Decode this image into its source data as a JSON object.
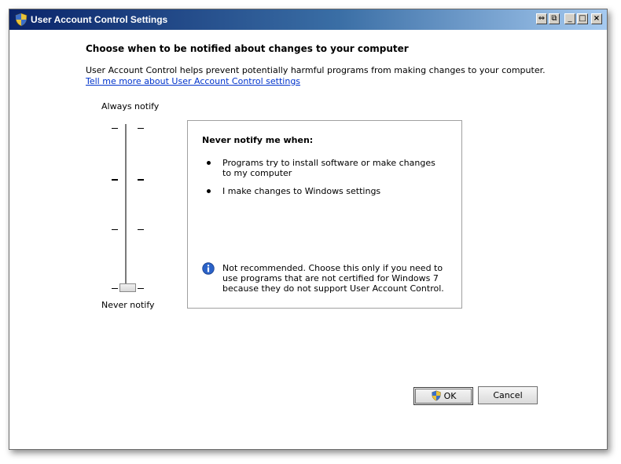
{
  "window": {
    "title": "User Account Control Settings",
    "controls": {
      "pin": "⇔",
      "restore": "⧉",
      "minimize": "_",
      "maximize": "□",
      "close": "×"
    }
  },
  "main": {
    "heading": "Choose when to be notified about changes to your computer",
    "description": "User Account Control helps prevent potentially harmful programs from making changes to your computer.",
    "link": "Tell me more about User Account Control settings"
  },
  "slider": {
    "top_label": "Always notify",
    "bottom_label": "Never notify",
    "levels": 4,
    "selected_level": 0
  },
  "info_box": {
    "title": "Never notify me when:",
    "bullets": [
      "Programs try to install software or make changes to my computer",
      "I make changes to Windows settings"
    ],
    "note": "Not recommended. Choose this only if you need to use programs that are not certified for Windows 7 because they do not support User Account Control."
  },
  "buttons": {
    "ok": "OK",
    "cancel": "Cancel"
  },
  "icons": {
    "title": "uac-shield-icon",
    "info": "info-icon",
    "ok": "uac-shield-icon"
  },
  "colors": {
    "link": "#0033cc",
    "title_bar_start": "#0a246a",
    "title_bar_end": "#a6caf0",
    "info_icon": "#2a62c8"
  }
}
